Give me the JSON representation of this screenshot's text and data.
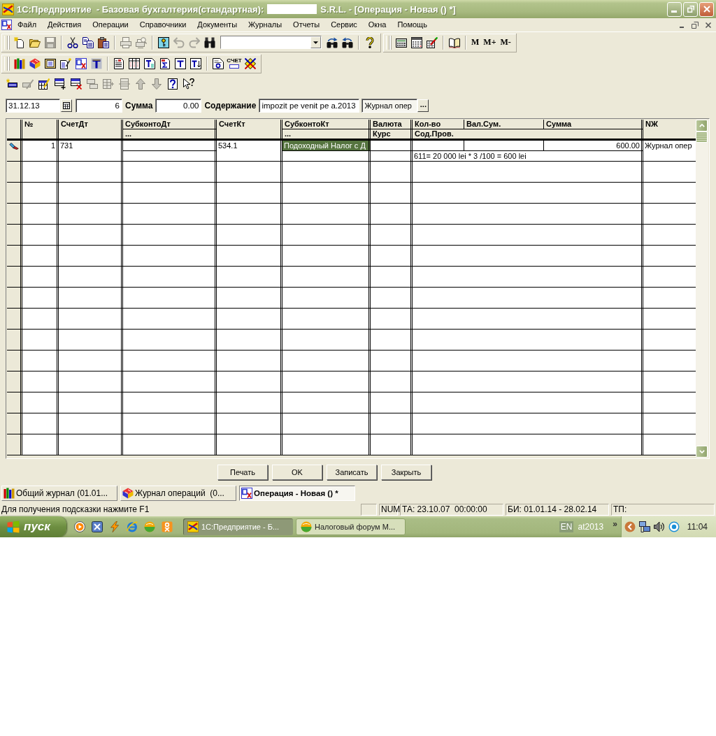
{
  "window": {
    "title": "1С:Предприятие  - Базовая бухгалтерия(стандартная):",
    "redacted_name": true,
    "title_end": "S.R.L. - [Операция - Новая () *]"
  },
  "menu": [
    "Файл",
    "Действия",
    "Операции",
    "Справочники",
    "Документы",
    "Журналы",
    "Отчеты",
    "Сервис",
    "Окна",
    "Помощь"
  ],
  "toolbar_rows": [
    [
      {
        "groups": [
          [
            {
              "kind": "new",
              "disabled": false
            },
            {
              "kind": "open",
              "disabled": false
            },
            {
              "kind": "save",
              "disabled": true
            }
          ],
          [
            {
              "kind": "cut",
              "disabled": false
            },
            {
              "kind": "copy",
              "disabled": false
            },
            {
              "kind": "paste",
              "disabled": false
            }
          ],
          [
            {
              "kind": "print",
              "disabled": true
            },
            {
              "kind": "preview",
              "disabled": true
            }
          ],
          [
            {
              "kind": "key-reference",
              "disabled": false
            },
            {
              "kind": "undo",
              "disabled": true
            },
            {
              "kind": "redo",
              "disabled": true
            },
            {
              "kind": "find",
              "disabled": false
            },
            {
              "kind": "search",
              "disabled": false
            },
            {
              "kind": "find-next",
              "disabled": false
            },
            {
              "kind": "find-previous",
              "disabled": false
            }
          ],
          [
            {
              "kind": "help",
              "disabled": false
            }
          ]
        ]
      },
      {
        "groups": [
          [
            {
              "kind": "calculator",
              "disabled": false
            },
            {
              "kind": "calendar",
              "disabled": false
            },
            {
              "kind": "grid-pen",
              "disabled": false
            }
          ],
          [
            {
              "kind": "book",
              "disabled": false
            }
          ],
          [
            {
              "kind": "memory",
              "label": "M",
              "disabled": false
            },
            {
              "kind": "memory",
              "label": "M+",
              "disabled": false
            },
            {
              "kind": "memory",
              "label": "M-",
              "disabled": false
            }
          ]
        ]
      }
    ],
    [
      {
        "groups": [
          [
            {
              "kind": "books",
              "disabled": false
            },
            {
              "kind": "catalog",
              "disabled": false
            },
            {
              "kind": "card-index",
              "disabled": false
            },
            {
              "kind": "doc-wand",
              "disabled": false
            },
            {
              "kind": "ledger",
              "disabled": false
            },
            {
              "kind": "t-shape",
              "disabled": false
            }
          ],
          [
            {
              "kind": "doc-lines",
              "disabled": false
            },
            {
              "kind": "doc-table",
              "disabled": false
            },
            {
              "kind": "doc-t",
              "disabled": false
            },
            {
              "kind": "doc-sigma",
              "disabled": false
            },
            {
              "kind": "t-frame",
              "disabled": false
            },
            {
              "kind": "t-arrow",
              "disabled": false
            }
          ],
          [
            {
              "kind": "doc-circle",
              "disabled": false
            },
            {
              "kind": "invoice",
              "label": "СЧЕТ",
              "disabled": false
            },
            {
              "kind": "diamond",
              "disabled": false
            }
          ]
        ]
      }
    ]
  ],
  "form_toolbar": [
    {
      "kind": "new-row",
      "disabled": false
    },
    {
      "kind": "row-pencil",
      "disabled": true
    },
    {
      "kind": "edit-grid",
      "disabled": false
    },
    {
      "kind": "add-row",
      "disabled": false
    },
    {
      "kind": "delete-row",
      "disabled": false
    },
    {
      "kind": "copy-rows",
      "disabled": true
    },
    {
      "kind": "grid-mark",
      "disabled": true
    },
    {
      "kind": "grid-lines",
      "disabled": true
    },
    {
      "kind": "move-up",
      "disabled": true
    },
    {
      "kind": "move-down",
      "disabled": true
    },
    {
      "kind": "help-doc",
      "disabled": false
    },
    {
      "kind": "pointer-help",
      "disabled": false
    }
  ],
  "form": {
    "date": "31.12.13",
    "number": "6",
    "sum_label": "Сумма",
    "sum": "0.00",
    "content_label": "Содержание",
    "content": "impozit pe venit pe a.2013",
    "journal": "Журнал опер",
    "journal_button": "..."
  },
  "table": {
    "header": {
      "no": "№",
      "account_dt": "СчетДт",
      "subconto_dt": "СубконтоДт",
      "subconto_dt_more": "...",
      "account_kt": "СчетКт",
      "subconto_kt": "СубконтоКт",
      "subconto_kt_more": "...",
      "currency": "Валюта",
      "rate": "Курс",
      "quantity": "Кол-во",
      "currency_sum": "Вал.Сум.",
      "sum": "Сумма",
      "entry_text": "Сод.Пров.",
      "journal": "NЖ"
    },
    "rows": [
      {
        "editing": true,
        "cells": {
          "no": {
            "text": "1",
            "selected": false
          },
          "account_dt": {
            "text": "731",
            "selected": false
          },
          "account_kt": {
            "text": "534.1",
            "selected": false
          },
          "subconto_kt": {
            "text": "Подоходный Налог с Д",
            "selected": true
          },
          "sum": {
            "text": "600.00",
            "selected": false
          },
          "entry_text": {
            "text": "611= 20 000 lei * 3 /100 = 600 lei",
            "selected": false
          },
          "journal": {
            "text": "Журнал опер",
            "selected": false
          }
        }
      }
    ]
  },
  "buttons": [
    "Печать",
    "OK",
    "Записать",
    "Закрыть"
  ],
  "window_tabs": [
    {
      "kind": "general-journal",
      "label": "Общий журнал (01.01...",
      "selected": false
    },
    {
      "kind": "operations-journal",
      "label": "Журнал операций  (0...",
      "selected": false
    },
    {
      "kind": "operation",
      "label": "Операция - Новая () *",
      "selected": true
    }
  ],
  "status_bar": {
    "hint": "Для получения подсказки нажмите F1",
    "panels": [
      "NUM",
      "ТА: 23.10.07  00:00:00",
      "БИ: 01.01.14 - 28.02.14",
      "ТП:"
    ]
  },
  "taskbar": {
    "start": "пуск",
    "quick_launch": [
      {
        "kind": "media-player"
      },
      {
        "kind": "x-app"
      },
      {
        "kind": "lightning"
      },
      {
        "kind": "web"
      },
      {
        "kind": "sphere"
      },
      {
        "kind": "social"
      }
    ],
    "tasks": [
      {
        "kind": "accounting",
        "label": "1С:Предприятие - Б...",
        "selected": true
      },
      {
        "kind": "browser",
        "label": "Налоговый форум М...",
        "selected": false
      }
    ],
    "language": "EN",
    "toolbar_label": "at2013",
    "more": "»",
    "tray": [
      {
        "kind": "back"
      },
      {
        "kind": "network"
      },
      {
        "kind": "speaker"
      },
      {
        "kind": "eye"
      }
    ],
    "clock": "11:04"
  }
}
